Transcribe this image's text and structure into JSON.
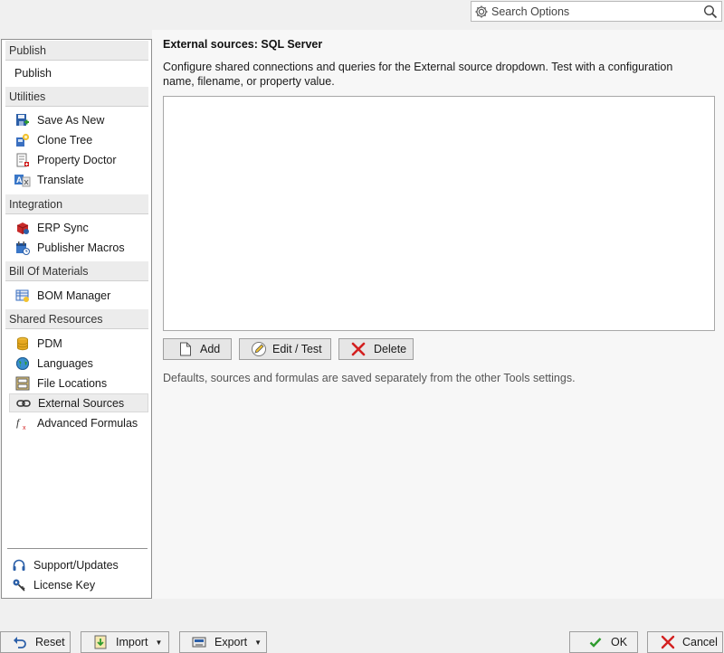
{
  "search": {
    "placeholder": "Search Options"
  },
  "sidebar": {
    "groups": [
      {
        "header": "Publish",
        "items": [
          {
            "label": "Publish",
            "icon": "none"
          }
        ]
      },
      {
        "header": "Utilities",
        "items": [
          {
            "label": "Save As New",
            "icon": "save-as-new-icon"
          },
          {
            "label": "Clone Tree",
            "icon": "clone-tree-icon"
          },
          {
            "label": "Property Doctor",
            "icon": "property-doctor-icon"
          },
          {
            "label": "Translate",
            "icon": "translate-icon"
          }
        ]
      },
      {
        "header": "Integration",
        "items": [
          {
            "label": "ERP Sync",
            "icon": "erp-sync-icon"
          },
          {
            "label": "Publisher Macros",
            "icon": "publisher-macros-icon"
          }
        ]
      },
      {
        "header": "Bill Of Materials",
        "items": [
          {
            "label": "BOM Manager",
            "icon": "bom-manager-icon"
          }
        ]
      },
      {
        "header": "Shared Resources",
        "items": [
          {
            "label": "PDM",
            "icon": "pdm-icon"
          },
          {
            "label": "Languages",
            "icon": "languages-icon"
          },
          {
            "label": "File Locations",
            "icon": "file-locations-icon"
          },
          {
            "label": "External Sources",
            "icon": "external-sources-icon",
            "selected": true
          },
          {
            "label": "Advanced Formulas",
            "icon": "advanced-formulas-icon"
          }
        ]
      }
    ],
    "footer": [
      {
        "label": "Support/Updates",
        "icon": "headset-icon"
      },
      {
        "label": "License Key",
        "icon": "key-icon"
      }
    ]
  },
  "main": {
    "title": "External sources: SQL Server",
    "description": "Configure shared connections and queries for the External source dropdown. Test with a configuration name, filename, or property value.",
    "buttons": {
      "add": "Add",
      "edit": "Edit / Test",
      "delete": "Delete"
    },
    "note": "Defaults, sources and formulas are saved separately from the other Tools settings."
  },
  "footer": {
    "reset": "Reset",
    "import": "Import",
    "export": "Export",
    "ok": "OK",
    "cancel": "Cancel"
  },
  "colors": {
    "selection_bg": "#ececec",
    "delete_red": "#d32020",
    "ok_green": "#2e9b2e"
  }
}
